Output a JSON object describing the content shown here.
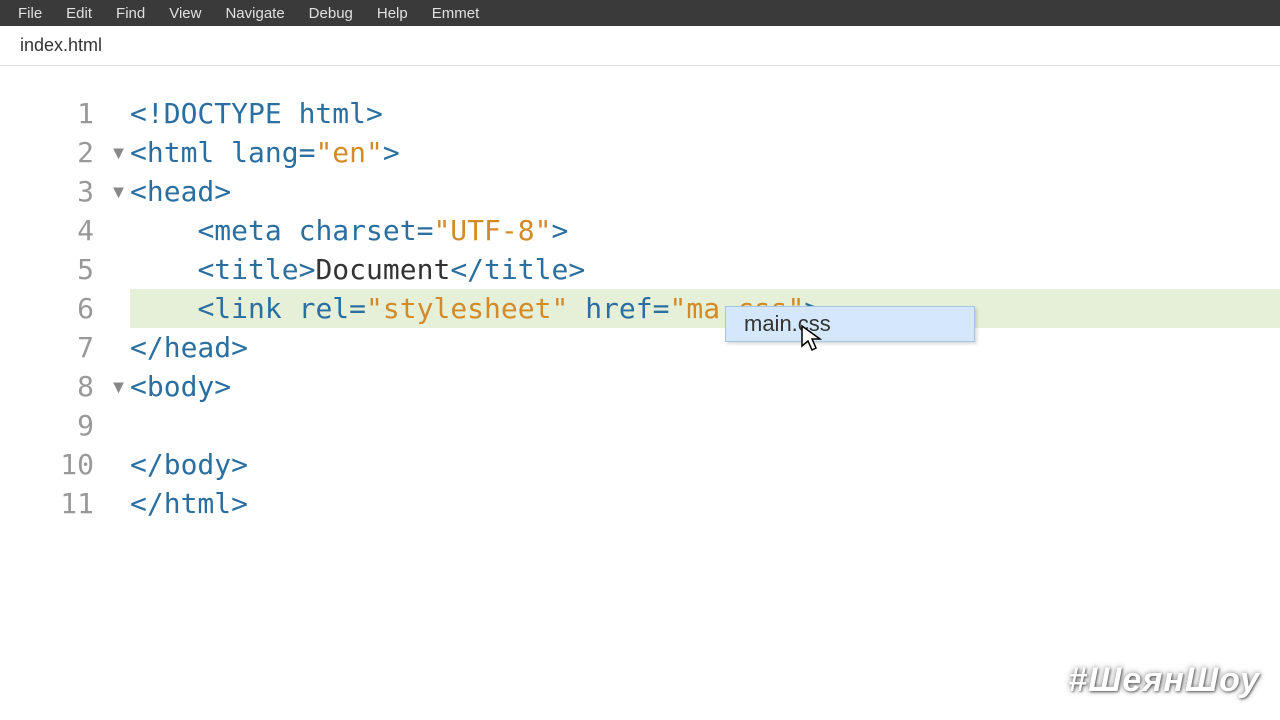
{
  "menubar": {
    "items": [
      "File",
      "Edit",
      "Find",
      "View",
      "Navigate",
      "Debug",
      "Help",
      "Emmet"
    ]
  },
  "tabbar": {
    "active_tab": "index.html"
  },
  "editor": {
    "lines": [
      {
        "num": "1",
        "fold": false,
        "indent": 0,
        "hl": false,
        "tokens": [
          {
            "t": "<!DOCTYPE html>",
            "c": "tok-tag"
          }
        ]
      },
      {
        "num": "2",
        "fold": true,
        "indent": 0,
        "hl": false,
        "tokens": [
          {
            "t": "<html ",
            "c": "tok-tag"
          },
          {
            "t": "lang=",
            "c": "tok-attr"
          },
          {
            "t": "\"en\"",
            "c": "tok-string"
          },
          {
            "t": ">",
            "c": "tok-tag"
          }
        ]
      },
      {
        "num": "3",
        "fold": true,
        "indent": 0,
        "hl": false,
        "tokens": [
          {
            "t": "<head>",
            "c": "tok-tag"
          }
        ]
      },
      {
        "num": "4",
        "fold": false,
        "indent": 1,
        "hl": false,
        "tokens": [
          {
            "t": "<meta ",
            "c": "tok-tag"
          },
          {
            "t": "charset=",
            "c": "tok-attr"
          },
          {
            "t": "\"UTF-8\"",
            "c": "tok-string"
          },
          {
            "t": ">",
            "c": "tok-tag"
          }
        ]
      },
      {
        "num": "5",
        "fold": false,
        "indent": 1,
        "hl": false,
        "tokens": [
          {
            "t": "<title>",
            "c": "tok-tag"
          },
          {
            "t": "Document",
            "c": "tok-text"
          },
          {
            "t": "</title>",
            "c": "tok-tag"
          }
        ]
      },
      {
        "num": "6",
        "fold": false,
        "indent": 1,
        "hl": true,
        "tokens": [
          {
            "t": "<link ",
            "c": "tok-tag"
          },
          {
            "t": "rel=",
            "c": "tok-attr"
          },
          {
            "t": "\"stylesheet\"",
            "c": "tok-string"
          },
          {
            "t": " ",
            "c": "tok-default"
          },
          {
            "t": "href=",
            "c": "tok-attr"
          },
          {
            "t": "\"ma.css\"",
            "c": "tok-string"
          },
          {
            "t": ">",
            "c": "tok-tag"
          }
        ]
      },
      {
        "num": "7",
        "fold": false,
        "indent": 0,
        "hl": false,
        "tokens": [
          {
            "t": "</head>",
            "c": "tok-tag"
          }
        ]
      },
      {
        "num": "8",
        "fold": true,
        "indent": 0,
        "hl": false,
        "tokens": [
          {
            "t": "<body>",
            "c": "tok-tag"
          }
        ]
      },
      {
        "num": "9",
        "fold": false,
        "indent": 1,
        "hl": false,
        "tokens": [
          {
            "t": "",
            "c": "tok-default"
          }
        ]
      },
      {
        "num": "10",
        "fold": false,
        "indent": 0,
        "hl": false,
        "tokens": [
          {
            "t": "</body>",
            "c": "tok-tag"
          }
        ]
      },
      {
        "num": "11",
        "fold": false,
        "indent": 0,
        "hl": false,
        "tokens": [
          {
            "t": "</html>",
            "c": "tok-tag"
          }
        ]
      }
    ]
  },
  "autocomplete": {
    "items": [
      "main.css"
    ]
  },
  "watermark": "#ШеянШоу"
}
